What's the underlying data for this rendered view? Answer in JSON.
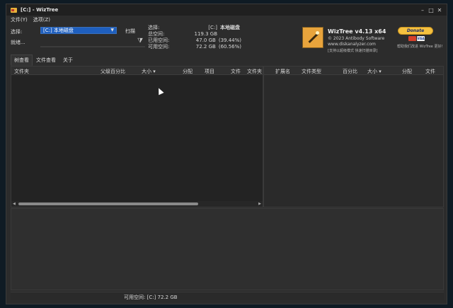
{
  "window": {
    "title": "[C:] - WizTree"
  },
  "menu": [
    "文件(Y)",
    "选项(Z)"
  ],
  "select": {
    "label": "选择:",
    "drive": "[C:] 本地磁盘",
    "scan": "扫描"
  },
  "status": "就绪...",
  "stats": {
    "select_label": "选择:",
    "select_value": "[C:]",
    "select_extra": "本地磁盘",
    "total_label": "总空间:",
    "total_value": "119.3 GB",
    "used_label": "已用空间:",
    "used_value": "47.0 GB",
    "used_pct": "(39.44%)",
    "free_label": "可用空间:",
    "free_value": "72.2 GB",
    "free_pct": "(60.56%)"
  },
  "brand": {
    "name": "WizTree v4.13 x64",
    "copyright": "© 2023 Antibody Software",
    "url": "www.diskanalyzer.com",
    "note": "[支持以超级模式 快速扫描目录]"
  },
  "donate": {
    "button": "Donate",
    "card_label": "VISA",
    "note": "帮助我们改进 WizTree 更好!"
  },
  "tabs": [
    "树查看",
    "文件查看",
    "关于"
  ],
  "left_columns": [
    "文件夹",
    "父级百分比",
    "大小 ▾",
    "分配",
    "项目",
    "文件",
    "文件夹"
  ],
  "right_columns": [
    "扩展名",
    "文件类型",
    "百分比",
    "大小 ▾",
    "分配",
    "文件"
  ],
  "statusbar": {
    "free": "可用空间: [C:] 72.2 GB"
  },
  "icons": {
    "app": "folder-icon",
    "filter": "filter-icon",
    "dropdown": "chevron-down-icon"
  },
  "colors": {
    "selection": "#1e5fbf",
    "donate": "#f5c140",
    "background": "#2c2c2c"
  }
}
